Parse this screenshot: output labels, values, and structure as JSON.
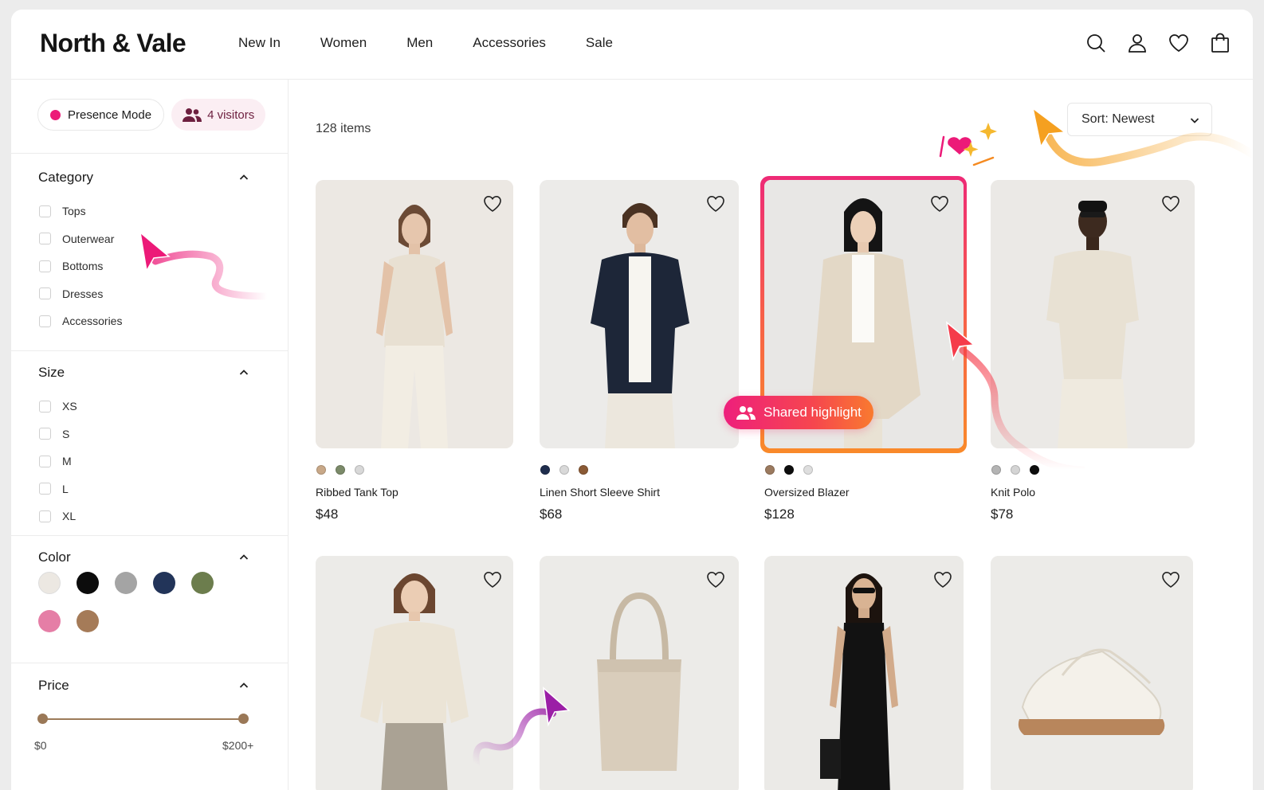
{
  "brand": "North & Vale",
  "nav": [
    "New In",
    "Women",
    "Men",
    "Accessories",
    "Sale"
  ],
  "header_icons": [
    "search-icon",
    "account-icon",
    "wishlist-heart-icon",
    "shopping-bag-icon"
  ],
  "presence": {
    "mode_label": "Presence Mode",
    "visitors_label": "4 visitors"
  },
  "filters": {
    "category": {
      "title": "Category",
      "options": [
        "Tops",
        "Outerwear",
        "Bottoms",
        "Dresses",
        "Accessories"
      ]
    },
    "size": {
      "title": "Size",
      "options": [
        "XS",
        "S",
        "M",
        "L",
        "XL"
      ]
    },
    "color": {
      "title": "Color",
      "swatches": [
        "#ece8e2",
        "#0c0c0c",
        "#a4a4a4",
        "#223459",
        "#6c7d4d",
        "#e57ea6",
        "#a57b58"
      ]
    },
    "price": {
      "title": "Price",
      "min_label": "$0",
      "max_label": "$200+"
    }
  },
  "toolbar": {
    "items_count": "128 items",
    "sort_label": "Sort: Newest"
  },
  "collab": {
    "shared_highlight_label": "Shared highlight",
    "cursor_colors": [
      "#ec1a78",
      "#f53b4a",
      "#f5a020",
      "#9b1fa6"
    ],
    "highlight_gradient": [
      "#ee2a76",
      "#f98a2a"
    ]
  },
  "products": [
    {
      "name": "Ribbed Tank Top",
      "price": "$48",
      "colors": [
        "#c8a888",
        "#7b8a69",
        "#d8d8d8"
      ]
    },
    {
      "name": "Linen Short Sleeve Shirt",
      "price": "$68",
      "colors": [
        "#1f2d4d",
        "#d9d9d9",
        "#8a5a35"
      ]
    },
    {
      "name": "Oversized Blazer",
      "price": "$128",
      "colors": [
        "#9b7a5f",
        "#0d0d0d",
        "#dedede"
      ]
    },
    {
      "name": "Knit Polo",
      "price": "$78",
      "colors": [
        "#b4b4b4",
        "#d4d4d4",
        "#0d0d0d"
      ]
    },
    {
      "name": "",
      "price": "",
      "colors": []
    },
    {
      "name": "",
      "price": "",
      "colors": []
    },
    {
      "name": "",
      "price": "",
      "colors": []
    },
    {
      "name": "",
      "price": "",
      "colors": []
    }
  ]
}
